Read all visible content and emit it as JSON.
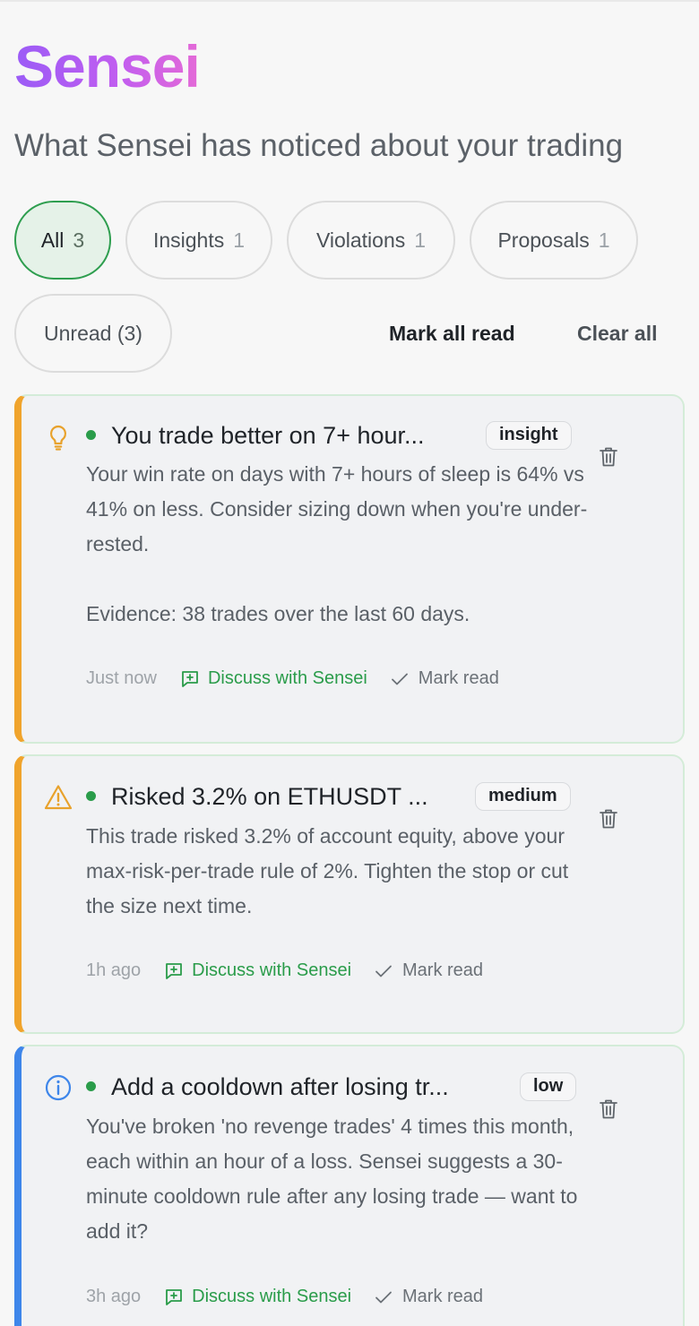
{
  "app": {
    "brand": "Sensei",
    "subtitle": "What Sensei has noticed about your trading"
  },
  "filters": [
    {
      "label": "All",
      "count": "3",
      "active": true
    },
    {
      "label": "Insights",
      "count": "1",
      "active": false
    },
    {
      "label": "Violations",
      "count": "1",
      "active": false
    },
    {
      "label": "Proposals",
      "count": "1",
      "active": false
    }
  ],
  "unread_filter": {
    "label": "Unread (3)"
  },
  "actions": {
    "mark_all_read": "Mark all read",
    "clear_all": "Clear all"
  },
  "cards": [
    {
      "icon": "lightbulb-icon",
      "accent": "#f0a42c",
      "title": "You trade better on 7+ hour...",
      "badge": "insight",
      "body": "Your win rate on days with 7+ hours of sleep is 64% vs 41% on less. Consider sizing down when you're under-rested.\n\nEvidence: 38 trades over the last 60 days.",
      "time": "Just now",
      "discuss": "Discuss with Sensei",
      "mark_read": "Mark read"
    },
    {
      "icon": "warning-icon",
      "accent": "#f0a42c",
      "title": "Risked 3.2% on ETHUSDT ...",
      "badge": "medium",
      "body": "This trade risked 3.2% of account equity, above your max-risk-per-trade rule of 2%. Tighten the stop or cut the size next time.",
      "time": "1h ago",
      "discuss": "Discuss with Sensei",
      "mark_read": "Mark read"
    },
    {
      "icon": "info-icon",
      "accent": "#3e86ea",
      "title": "Add a cooldown after losing tr...",
      "badge": "low",
      "body": "You've broken 'no revenge trades' 4 times this month, each within an hour of a loss. Sensei suggests a 30-minute cooldown rule after any losing trade — want to add it?",
      "time": "3h ago",
      "discuss": "Discuss with Sensei",
      "mark_read": "Mark read"
    }
  ]
}
